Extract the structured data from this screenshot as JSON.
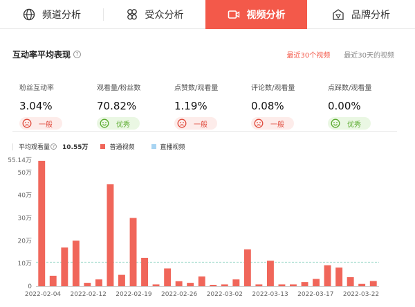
{
  "tabs": [
    {
      "label": "频道分析",
      "icon": "globe-icon",
      "active": false
    },
    {
      "label": "受众分析",
      "icon": "audience-icon",
      "active": false
    },
    {
      "label": "视频分析",
      "icon": "video-icon",
      "active": true
    },
    {
      "label": "品牌分析",
      "icon": "brand-icon",
      "active": false
    }
  ],
  "section": {
    "title": "互动率平均表现",
    "range_tabs": [
      {
        "label": "最近30个视频",
        "active": true
      },
      {
        "label": "最近30天的视频",
        "active": false
      }
    ]
  },
  "metrics": [
    {
      "label": "粉丝互动率",
      "value": "3.04%",
      "badge": "一般",
      "status": "bad"
    },
    {
      "label": "观看量/粉丝数",
      "value": "70.82%",
      "badge": "优秀",
      "status": "good"
    },
    {
      "label": "点赞数/观看量",
      "value": "1.19%",
      "badge": "一般",
      "status": "bad"
    },
    {
      "label": "评论数/观看量",
      "value": "0.08%",
      "badge": "一般",
      "status": "bad"
    },
    {
      "label": "点踩数/观看量",
      "value": "0.00%",
      "badge": "优秀",
      "status": "good"
    }
  ],
  "legend": {
    "avg_label": "平均观看量",
    "avg_value": "10.55万",
    "normal_label": "普通视频",
    "live_label": "直播视频",
    "normal_color": "#f0665a",
    "live_color": "#a8d4f2"
  },
  "colors": {
    "accent": "#f3594a",
    "bad": "#e04a3c",
    "good": "#5aab2e"
  },
  "chart_data": {
    "type": "bar",
    "title": "",
    "max_label": "55.14万",
    "yticks": [
      "0",
      "10万",
      "20万",
      "30万",
      "40万",
      "50万"
    ],
    "ylim": [
      0,
      55.14
    ],
    "average": 10.55,
    "xtick_labels": [
      "2022-02-04",
      "2022-02-12",
      "2022-02-19",
      "2022-02-26",
      "2022-03-02",
      "2022-03-13",
      "2022-03-17",
      "2022-03-22"
    ],
    "values": [
      55.14,
      4.6,
      17.0,
      20.0,
      1.5,
      3.0,
      44.8,
      5.0,
      30.0,
      12.5,
      0.8,
      7.8,
      2.2,
      1.5,
      4.3,
      0.6,
      0.8,
      3.0,
      16.2,
      0.8,
      11.2,
      0.8,
      0.8,
      1.8,
      3.2,
      9.2,
      8.2,
      4.0,
      1.0,
      2.3
    ]
  }
}
